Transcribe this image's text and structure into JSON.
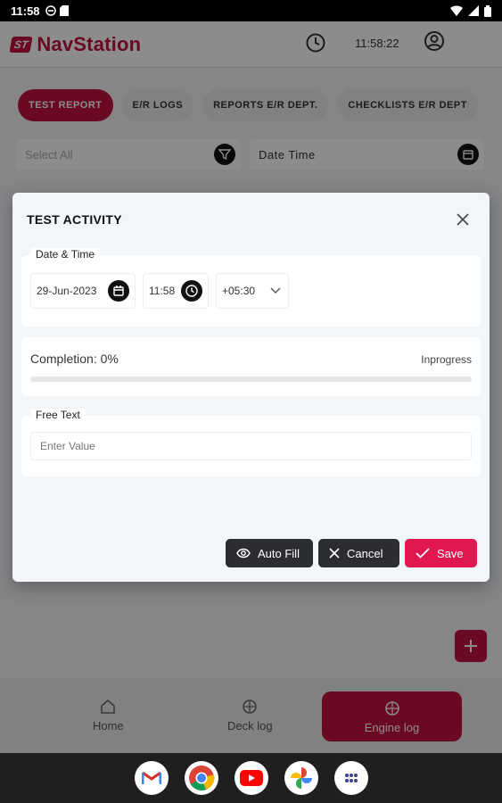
{
  "status_bar": {
    "time": "11:58"
  },
  "app": {
    "brand_badge": "ST",
    "brand_name": "NavStation",
    "clock_time": "11:58:22"
  },
  "tabs": [
    {
      "label": "TEST REPORT",
      "active": true
    },
    {
      "label": "E/R LOGS",
      "active": false
    },
    {
      "label": "REPORTS E/R DEPT.",
      "active": false
    },
    {
      "label": "CHECKLISTS E/R DEPT",
      "active": false
    }
  ],
  "filters": {
    "select_all_placeholder": "Select All",
    "date_time_label": "Date Time"
  },
  "dialog": {
    "title": "TEST ACTIVITY",
    "date_time_legend": "Date & Time",
    "date_value": "29-Jun-2023",
    "time_value": "11:58",
    "timezone_value": "+05:30",
    "completion_label": "Completion: 0%",
    "completion_percent": 0,
    "completion_status": "Inprogress",
    "free_text_legend": "Free Text",
    "free_text_placeholder": "Enter Value",
    "buttons": {
      "auto_fill": "Auto Fill",
      "cancel": "Cancel",
      "save": "Save"
    }
  },
  "bottom_nav": [
    {
      "label": "Home",
      "icon": "home-icon",
      "active": false
    },
    {
      "label": "Deck log",
      "icon": "deck-log-icon",
      "active": false
    },
    {
      "label": "Engine log",
      "icon": "engine-log-icon",
      "active": true
    }
  ],
  "android_apps": [
    "gmail-icon",
    "chrome-icon",
    "youtube-icon",
    "photos-icon",
    "app-drawer-icon"
  ],
  "colors": {
    "accent": "#c2123e",
    "save_button": "#e0184f",
    "dark_button": "#2b2d31"
  }
}
